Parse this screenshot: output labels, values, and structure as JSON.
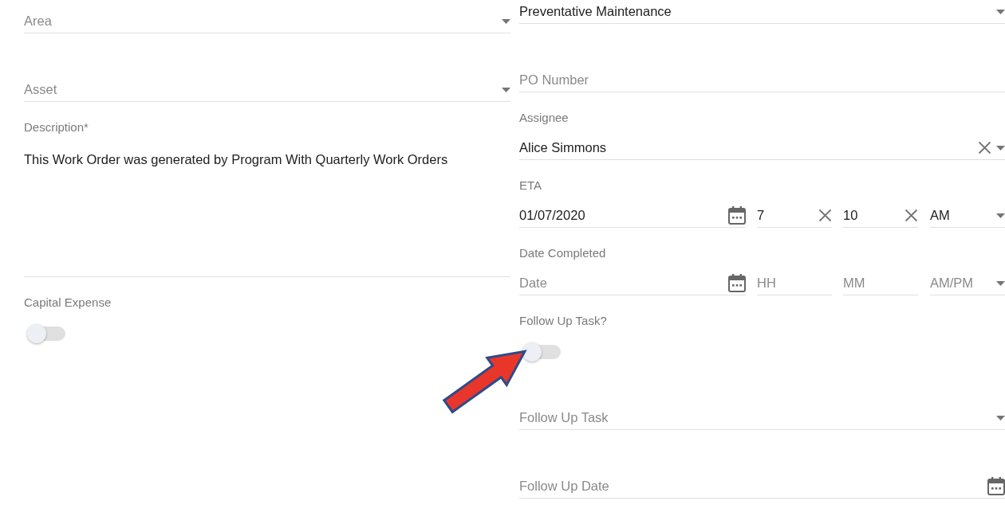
{
  "left_fields": [
    {
      "kind": "select",
      "placeholder": "Area"
    },
    {
      "kind": "select",
      "placeholder": "Asset"
    },
    {
      "kind": "textarea",
      "label": "Description*",
      "value": "This Work Order was generated by Program With Quarterly Work Orders"
    },
    {
      "kind": "toggle",
      "label": "Capital Expense",
      "on": false
    }
  ],
  "right_fields": [
    {
      "kind": "select",
      "value": "Preventative Maintenance"
    },
    {
      "kind": "text",
      "placeholder": "PO Number"
    },
    {
      "kind": "select",
      "label": "Assignee",
      "value": "Alice Simmons",
      "clearable": true
    },
    {
      "kind": "datetime",
      "label": "ETA",
      "date": {
        "value": "01/07/2020"
      },
      "hour": {
        "value": "7"
      },
      "minute": {
        "value": "10"
      },
      "ampm": {
        "value": "AM"
      }
    },
    {
      "kind": "datetime",
      "label": "Date Completed",
      "date": {
        "placeholder": "Date"
      },
      "hour": {
        "placeholder": "HH"
      },
      "minute": {
        "placeholder": "MM"
      },
      "ampm": {
        "placeholder": "AM/PM"
      }
    },
    {
      "kind": "toggle",
      "label": "Follow Up Task?",
      "on": false
    },
    {
      "kind": "select",
      "placeholder": "Follow Up Task"
    },
    {
      "kind": "date",
      "placeholder": "Follow Up Date"
    }
  ],
  "annotation": {
    "kind": "arrow"
  }
}
